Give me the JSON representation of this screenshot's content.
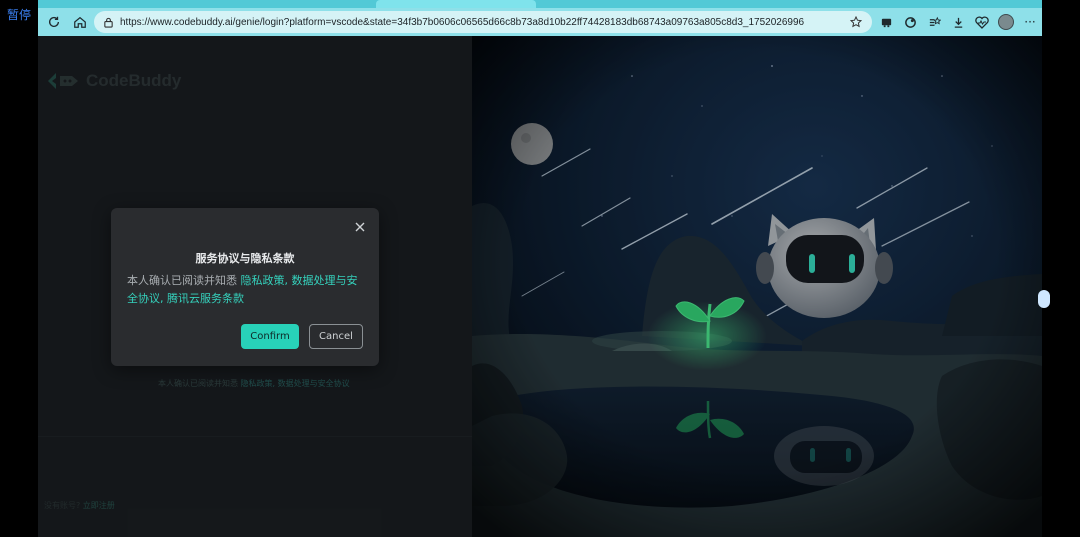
{
  "overlay_label": "暂停",
  "browser": {
    "url": "https://www.codebuddy.ai/genie/login?platform=vscode&state=34f3b7b0606c06565d66c8b73a8d10b22ff74428183db68743a09763a805c8d3_1752026996",
    "icons": [
      "reload-icon",
      "home-icon",
      "lock-icon",
      "star-icon",
      "extension-icon",
      "copilot-icon",
      "collections-icon",
      "download-icon",
      "health-icon",
      "profile-icon",
      "more-icon"
    ],
    "more_label": "···"
  },
  "brand": {
    "name": "CodeBuddy"
  },
  "background_text": {
    "notice": "本人确认已阅读并知悉",
    "notice_links": "隐私政策, 数据处理与安全协议",
    "bottom_prefix": "没有账号?",
    "bottom_link": "立即注册"
  },
  "dialog": {
    "title": "服务协议与隐私条款",
    "text_prefix": "本人确认已阅读并知悉",
    "link_privacy": "隐私政策",
    "link_data": "数据处理与安全协议",
    "link_tencent": "腾讯云服务条款",
    "sep1": ", ",
    "sep2": ", ",
    "confirm_label": "Confirm",
    "cancel_label": "Cancel"
  },
  "colors": {
    "accent": "#28d1b8",
    "toolbar": "#8ee0e9",
    "dialog_bg": "#2a2c2f"
  }
}
